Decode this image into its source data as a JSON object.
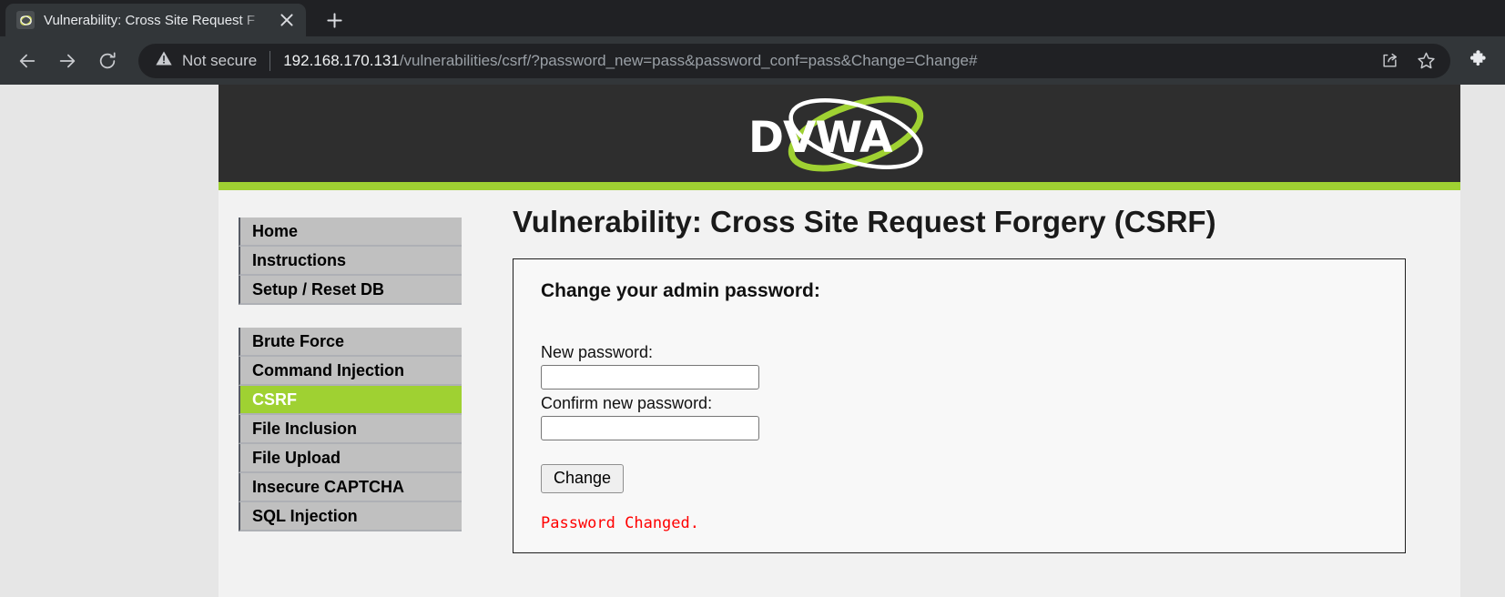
{
  "browser": {
    "tab": {
      "title": "Vulnerability: Cross Site Request F",
      "favicon_icon": "dvwa-favicon-icon",
      "close_icon": "close-icon"
    },
    "new_tab_icon": "plus-icon",
    "nav": {
      "back_icon": "back-arrow-icon",
      "forward_icon": "forward-arrow-icon",
      "reload_icon": "reload-icon"
    },
    "omnibox": {
      "security_icon": "not-secure-warning-icon",
      "security_text": "Not secure",
      "url_host": "192.168.170.131",
      "url_path": "/vulnerabilities/csrf/?password_new=pass&password_conf=pass&Change=Change#",
      "share_icon": "share-icon",
      "bookmark_icon": "star-icon"
    },
    "extensions_icon": "puzzle-piece-icon"
  },
  "site": {
    "logo_text": "DVWA",
    "accent_green": "#9fd132",
    "header_dark": "#2e2e2e"
  },
  "sidebar": {
    "groups": [
      {
        "items": [
          {
            "label": "Home",
            "active": false
          },
          {
            "label": "Instructions",
            "active": false
          },
          {
            "label": "Setup / Reset DB",
            "active": false
          }
        ]
      },
      {
        "items": [
          {
            "label": "Brute Force",
            "active": false
          },
          {
            "label": "Command Injection",
            "active": false
          },
          {
            "label": "CSRF",
            "active": true
          },
          {
            "label": "File Inclusion",
            "active": false
          },
          {
            "label": "File Upload",
            "active": false
          },
          {
            "label": "Insecure CAPTCHA",
            "active": false
          },
          {
            "label": "SQL Injection",
            "active": false
          }
        ]
      }
    ]
  },
  "main": {
    "page_title": "Vulnerability: Cross Site Request Forgery (CSRF)",
    "panel": {
      "title": "Change your admin password:",
      "new_password_label": "New password:",
      "new_password_value": "",
      "confirm_password_label": "Confirm new password:",
      "confirm_password_value": "",
      "submit_label": "Change",
      "status_message": "Password Changed.",
      "status_color": "#ff0000"
    }
  }
}
